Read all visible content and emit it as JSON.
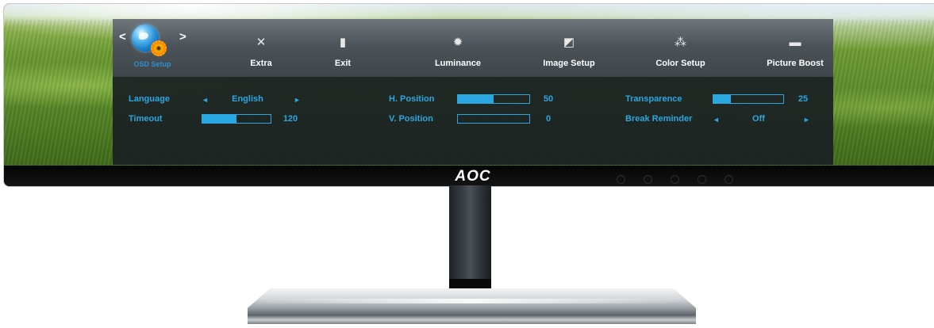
{
  "brand": {
    "logo": "AOC"
  },
  "osd": {
    "tabs": [
      {
        "label": "OSD Setup",
        "icon": "globe-gear-icon",
        "selected": true
      },
      {
        "label": "Extra",
        "icon": "tools-icon"
      },
      {
        "label": "Exit",
        "icon": "exit-door-icon"
      },
      {
        "label": "Luminance",
        "icon": "brightness-icon"
      },
      {
        "label": "Image Setup",
        "icon": "image-setup-icon"
      },
      {
        "label": "Color Setup",
        "icon": "color-dots-icon"
      },
      {
        "label": "Picture Boost",
        "icon": "picture-boost-icon"
      }
    ],
    "nav": {
      "prev": "<",
      "next": ">"
    },
    "settings": {
      "language": {
        "label": "Language",
        "value": "English",
        "left": "◄",
        "right": "►"
      },
      "timeout": {
        "label": "Timeout",
        "value": "120",
        "level": 0.5
      },
      "h_position": {
        "label": "H. Position",
        "value": "50",
        "level": 0.5
      },
      "v_position": {
        "label": "V. Position",
        "value": "0",
        "level": 0.0
      },
      "transparence": {
        "label": "Transparence",
        "value": "25",
        "level": 0.25
      },
      "break_reminder": {
        "label": "Break Reminder",
        "value": "Off",
        "left": "◄",
        "right": "►"
      }
    }
  },
  "colors": {
    "accent": "#2aa7e0",
    "osd_bg": "#1b2024",
    "tab_bg": "#4c5459"
  }
}
